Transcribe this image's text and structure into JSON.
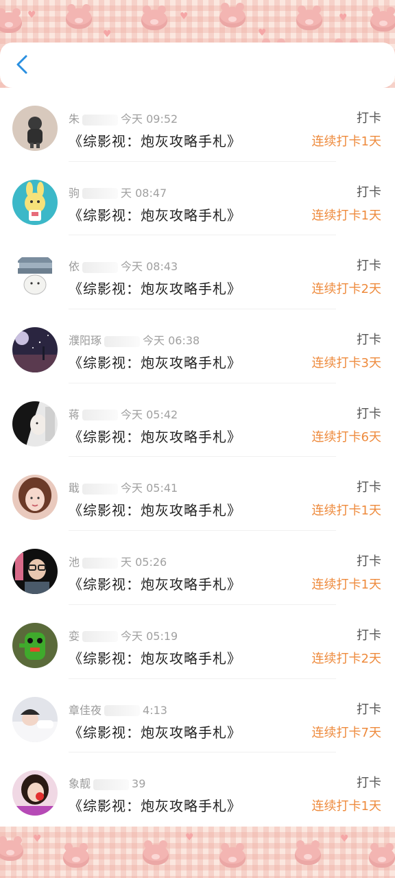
{
  "header": {
    "back_label": "<"
  },
  "accent_color": "#ee8a3c",
  "entries": [
    {
      "name": "朱",
      "time": "今天 09:52",
      "book": "《综影视：炮灰攻略手札》",
      "action": "打卡",
      "streak": "连续打卡1天",
      "avatar_icon": "child-photo-avatar"
    },
    {
      "name": "驹",
      "time": "天 08:47",
      "book": "《综影视：炮灰攻略手札》",
      "action": "打卡",
      "streak": "连续打卡1天",
      "avatar_icon": "cartoon-rabbit-avatar"
    },
    {
      "name": "依",
      "time": "今天 08:43",
      "book": "《综影视：炮灰攻略手札》",
      "action": "打卡",
      "streak": "连续打卡2天",
      "avatar_icon": "books-stack-avatar"
    },
    {
      "name": "濮阳琢",
      "time": "今天 06:38",
      "book": "《综影视：炮灰攻略手札》",
      "action": "打卡",
      "streak": "连续打卡3天",
      "avatar_icon": "night-sky-avatar"
    },
    {
      "name": "蒋",
      "time": "今天 05:42",
      "book": "《综影视：炮灰攻略手札》",
      "action": "打卡",
      "streak": "连续打卡6天",
      "avatar_icon": "portrait-bw-avatar"
    },
    {
      "name": "戢",
      "time": "今天 05:41",
      "book": "《综影视：炮灰攻略手札》",
      "action": "打卡",
      "streak": "连续打卡1天",
      "avatar_icon": "girl-portrait-avatar"
    },
    {
      "name": "池",
      "time": "天 05:26",
      "book": "《综影视：炮灰攻略手札》",
      "action": "打卡",
      "streak": "连续打卡1天",
      "avatar_icon": "glasses-man-avatar"
    },
    {
      "name": "娈",
      "time": "今天 05:19",
      "book": "《综影视：炮灰攻略手札》",
      "action": "打卡",
      "streak": "连续打卡2天",
      "avatar_icon": "green-toy-avatar"
    },
    {
      "name": "章佳夜",
      "time": "4:13",
      "book": "《综影视：炮灰攻略手札》",
      "action": "打卡",
      "streak": "连续打卡7天",
      "avatar_icon": "lying-girl-avatar"
    },
    {
      "name": "象靓",
      "time": "39",
      "book": "《综影视：炮灰攻略手札》",
      "action": "打卡",
      "streak": "连续打卡1天",
      "avatar_icon": "girl-red-avatar"
    }
  ]
}
